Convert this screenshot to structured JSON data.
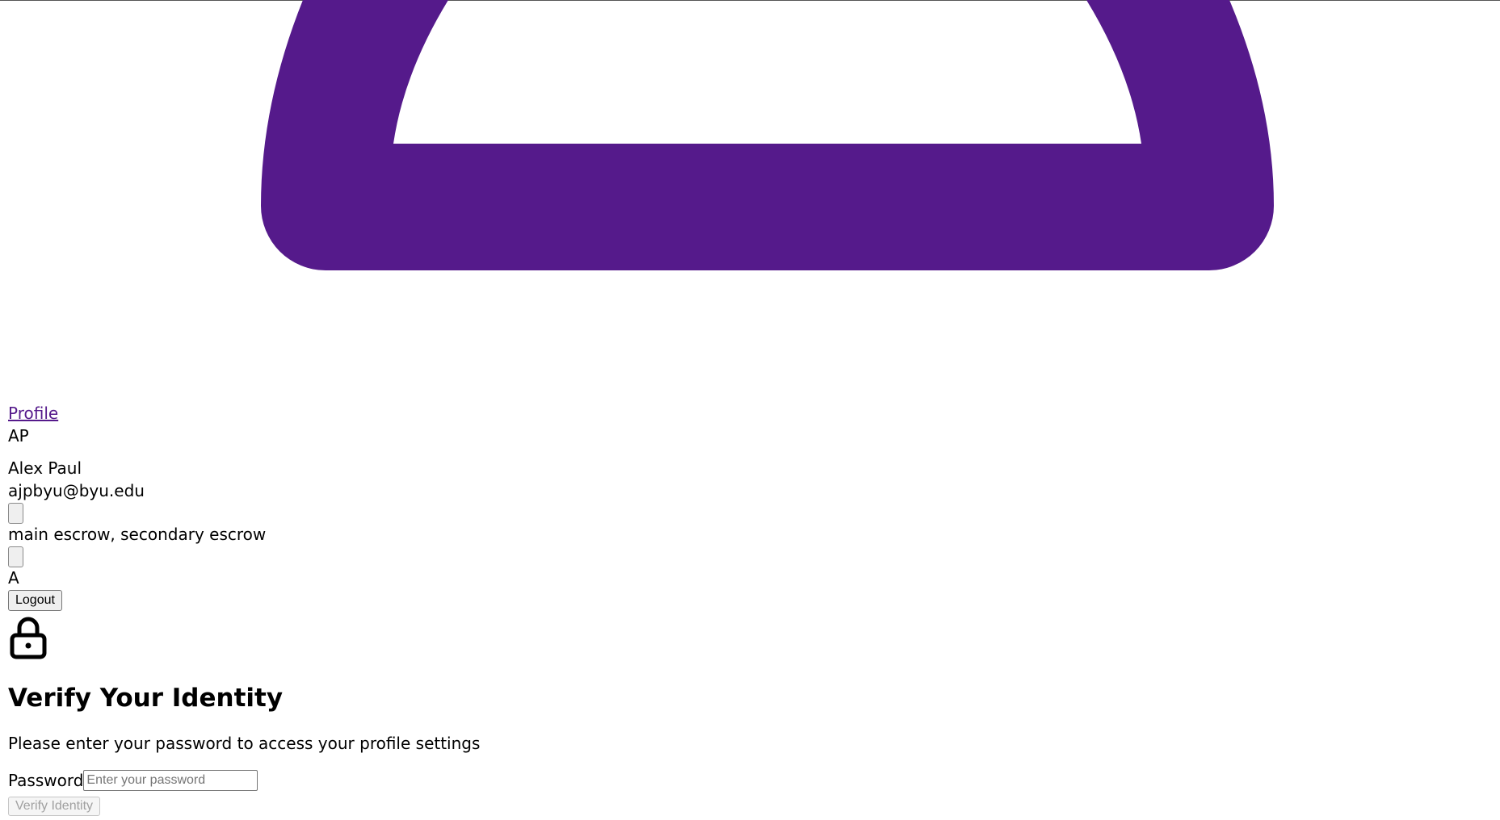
{
  "colors": {
    "brand_purple": "#551a8b",
    "logo_purple": "#551a8b"
  },
  "logo": {
    "icon": "lock-shackle-logo"
  },
  "nav": {
    "profile_link": "Profile"
  },
  "user": {
    "initials": "AP",
    "name": "Alex Paul",
    "email": "ajpbyu@byu.edu",
    "escrows": "main escrow, secondary escrow",
    "role_initial": "A"
  },
  "actions": {
    "logout_label": "Logout"
  },
  "verify": {
    "icon": "lock-icon",
    "title": "Verify Your Identity",
    "subtitle": "Please enter your password to access your profile settings",
    "password_label": "Password",
    "password_placeholder": "Enter your password",
    "button_label": "Verify Identity"
  }
}
